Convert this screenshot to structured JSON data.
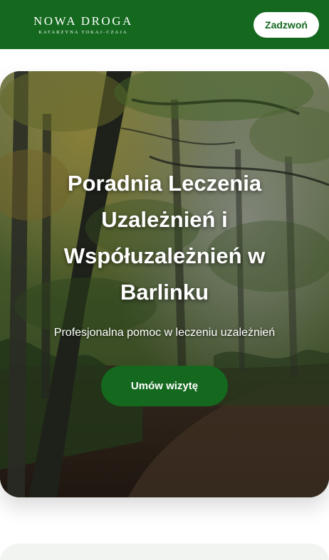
{
  "header": {
    "logo_title": "NOWA DROGA",
    "logo_subtitle": "KATARZYNA TOKAJ-CZAJA",
    "call_button_label": "Zadzwoń"
  },
  "hero": {
    "title": "Poradnia Leczenia Uzależnień i Współuzależnień w Barlinku",
    "subtitle": "Profesjonalna pomoc w leczeniu uzależnień",
    "cta_label": "Umów wizytę",
    "background_icon": "forest-photo"
  },
  "colors": {
    "brand_green": "#14691f",
    "white": "#ffffff",
    "section_bg": "#f1f4f0"
  }
}
